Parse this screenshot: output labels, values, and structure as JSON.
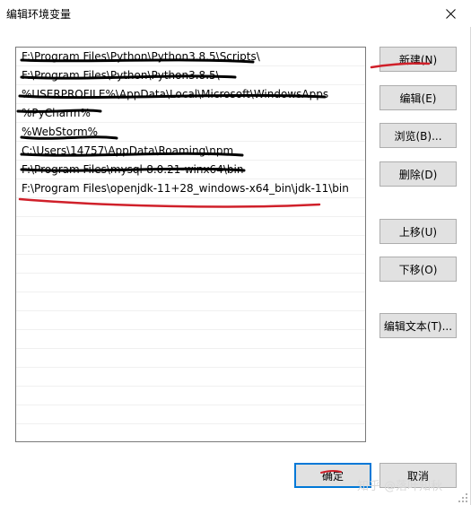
{
  "window": {
    "title": "编辑环境变量"
  },
  "list": {
    "items": [
      "F:\\Program Files\\Python\\Python3.8.5\\Scripts\\",
      "F:\\Program Files\\Python\\Python3.8.5\\",
      "%USERPROFILE%\\AppData\\Local\\Microsoft\\WindowsApps",
      "%PyCharm%",
      "%WebStorm%",
      "C:\\Users\\14757\\AppData\\Roaming\\npm",
      "F:\\Program Files\\mysql-8.0.21-winx64\\bin",
      "F:\\Program Files\\openjdk-11+28_windows-x64_bin\\jdk-11\\bin"
    ]
  },
  "buttons": {
    "new": "新建(N)",
    "edit": "编辑(E)",
    "browse": "浏览(B)...",
    "delete": "删除(D)",
    "move_up": "上移(U)",
    "move_down": "下移(O)",
    "edit_text": "编辑文本(T)...",
    "ok": "确定",
    "cancel": "取消"
  },
  "watermark": "知乎 @落叶知秋",
  "colors": {
    "accent": "#0078d7",
    "annotation_red": "#d0202a",
    "annotation_black": "#000000"
  }
}
